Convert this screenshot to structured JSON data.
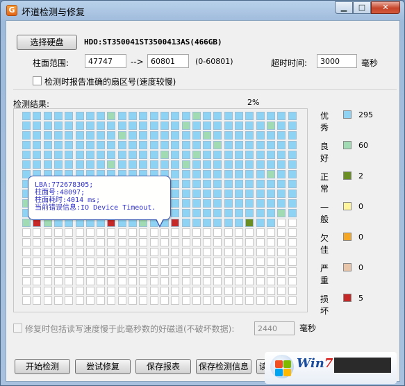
{
  "window": {
    "title": "坏道检测与修复"
  },
  "titlebar_buttons": {
    "minimize": "▁",
    "maximize": "□",
    "close": "✕"
  },
  "disk": {
    "select_button": "选择硬盘",
    "name": "HDO:ST350041ST3500413AS(466GB)"
  },
  "range": {
    "label": "柱面范围:",
    "start": "47747",
    "arrow": "-->",
    "end": "60801",
    "hint": "(0-60801)"
  },
  "timeout": {
    "label": "超时时间:",
    "value": "3000",
    "unit": "毫秒"
  },
  "options": {
    "report_sector": "检测时报告准确的扇区号(速度较慢)"
  },
  "results": {
    "label": "检测结果:",
    "progress": "2%"
  },
  "grid": {
    "cols": 26,
    "rows": 20,
    "scanned_rows": 12,
    "colors": {
      "blue": "#8fd3f4",
      "green": "#a0dbb4",
      "olive": "#6b8e23",
      "red": "#c62828",
      "empty": "#ffffff"
    },
    "cells_r0": "BBBBBBBBGBBBBBBBGBBBBBBBBB",
    "cells_r1": "BBBBBBBBBBBBBBBGBBBBBBBGBB",
    "cells_r2": "BBBBBBBBBGBBBBBBBGBBBBBBBB",
    "cells_r3": "BBBBBBBBBBBBBBBBBBGBBBBBBB",
    "cells_r4": "BBBBBBBBBBBBBGBBGBBBBBBBBB",
    "cells_r5": "BBBBBBBBGBBBBBBGBBBBBBBBBB",
    "cells_r6": "BBBBBBBBBBBBBBBBBBBBBBBGBB",
    "cells_r7": "BBBBBBBBBBBBBBBBBBBBBBBBBB",
    "cells_r8": "BBBBBBBBBBBBBBBBBBBBBBBBBB",
    "cells_r9": "GBBBBBBBBBBBBBBBBBBBBBBBBB",
    "cells_r10": "BROBBBBBBBBBBBBBBBBBBBBBGB",
    "cells_r11": "GRGBBBBBRBBGBBRBBBBBBOBBEE"
  },
  "tooltip": {
    "lba": "LBA:772678305;",
    "cylinder": "柱面号:48097;",
    "time": "柱面耗时:4014 ms;",
    "error": "当前错误信息:IO Device Timeout."
  },
  "legend": [
    {
      "label": "优秀",
      "color": "#8fd3f4",
      "count": "295"
    },
    {
      "label": "良好",
      "color": "#a0dbb4",
      "count": "60"
    },
    {
      "label": "正常",
      "color": "#6b8e23",
      "count": "2"
    },
    {
      "label": "一般",
      "color": "#fff59d",
      "count": "0"
    },
    {
      "label": "欠佳",
      "color": "#f5a623",
      "count": "0"
    },
    {
      "label": "严重",
      "color": "#e8c4a8",
      "count": "0"
    },
    {
      "label": "损坏",
      "color": "#c62828",
      "count": "5"
    }
  ],
  "repair": {
    "option": "修复时包括读写速度慢于此毫秒数的好磁道(不破坏数据):",
    "value": "2440",
    "unit": "毫秒"
  },
  "actions": {
    "start": "开始检测",
    "repair": "尝试修复",
    "save_report": "保存报表",
    "save_info": "保存检测信息",
    "read": "读"
  },
  "watermark": {
    "brand_a": "Win",
    "brand_b": "7"
  }
}
